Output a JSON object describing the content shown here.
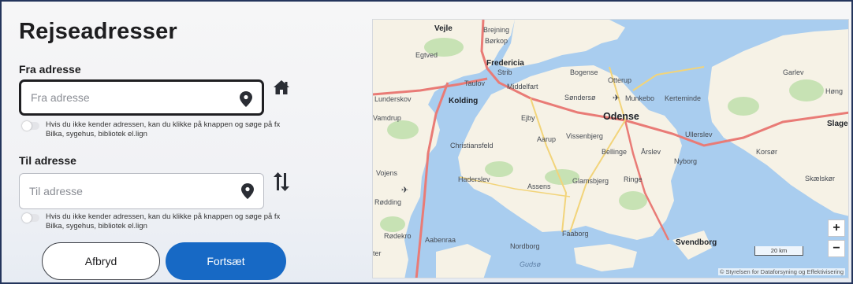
{
  "page": {
    "title": "Rejseadresser"
  },
  "from": {
    "label": "Fra adresse",
    "placeholder": "Fra adresse",
    "value": "",
    "hint": "Hvis du ikke kender adressen, kan du klikke på knappen og søge på fx Bilka, sygehus, bibliotek el.lign",
    "side_icon": "home-icon",
    "field_icon": "location-pin-icon"
  },
  "to": {
    "label": "Til adresse",
    "placeholder": "Til adresse",
    "value": "",
    "hint": "Hvis du ikke kender adressen, kan du klikke på knappen og søge på fx Bilka, sygehus, bibliotek el.lign",
    "side_icon": "swap-arrows-icon",
    "field_icon": "location-pin-icon"
  },
  "buttons": {
    "cancel": "Afbryd",
    "continue": "Fortsæt"
  },
  "map": {
    "labels": {
      "vejle": "Vejle",
      "brejning": "Brejning",
      "borkop": "Børkop",
      "egtved": "Egtved",
      "fredericia": "Fredericia",
      "strib": "Strib",
      "taulov": "Taulov",
      "middelfart": "Middelfart",
      "kolding": "Kolding",
      "lunderskov": "Lunderskov",
      "bogense": "Bogense",
      "otterup": "Otterup",
      "sonderso": "Søndersø",
      "munkebo": "Munkebo",
      "kerteminde": "Kerteminde",
      "garlev": "Garlev",
      "hong": "Høng",
      "odense": "Odense",
      "vamdrup": "Vamdrup",
      "ejby": "Ejby",
      "christiansfeld": "Christiansfeld",
      "aarup": "Aarup",
      "vissenbjerg": "Vissenbjerg",
      "ullerslev": "Ullerslev",
      "bellinge": "Bellinge",
      "arslev": "Årslev",
      "nyborg": "Nyborg",
      "korsor": "Korsør",
      "slagelse": "Slage",
      "vojens": "Vojens",
      "haderslev": "Haderslev",
      "assens": "Assens",
      "glamsbjerg": "Glamsbjerg",
      "ringe": "Ringe",
      "skaelskor": "Skælskør",
      "rodding": "Rødding",
      "faaborg": "Faaborg",
      "rodekro": "Rødekro",
      "aabenraa": "Aabenraa",
      "nordborg": "Nordborg",
      "svendborg": "Svendborg",
      "gudsoe": "Gudsø",
      "ter": "ter"
    },
    "zoom_in": "+",
    "zoom_out": "−",
    "scale": "20 km",
    "attribution": "© Styrelsen for Dataforsyning og Effektivisering",
    "colors": {
      "sea": "#a9cdef",
      "land": "#f6f2e6",
      "forest": "#c7e2b4",
      "motorway": "#e97b76",
      "road": "#f2d47a"
    }
  }
}
